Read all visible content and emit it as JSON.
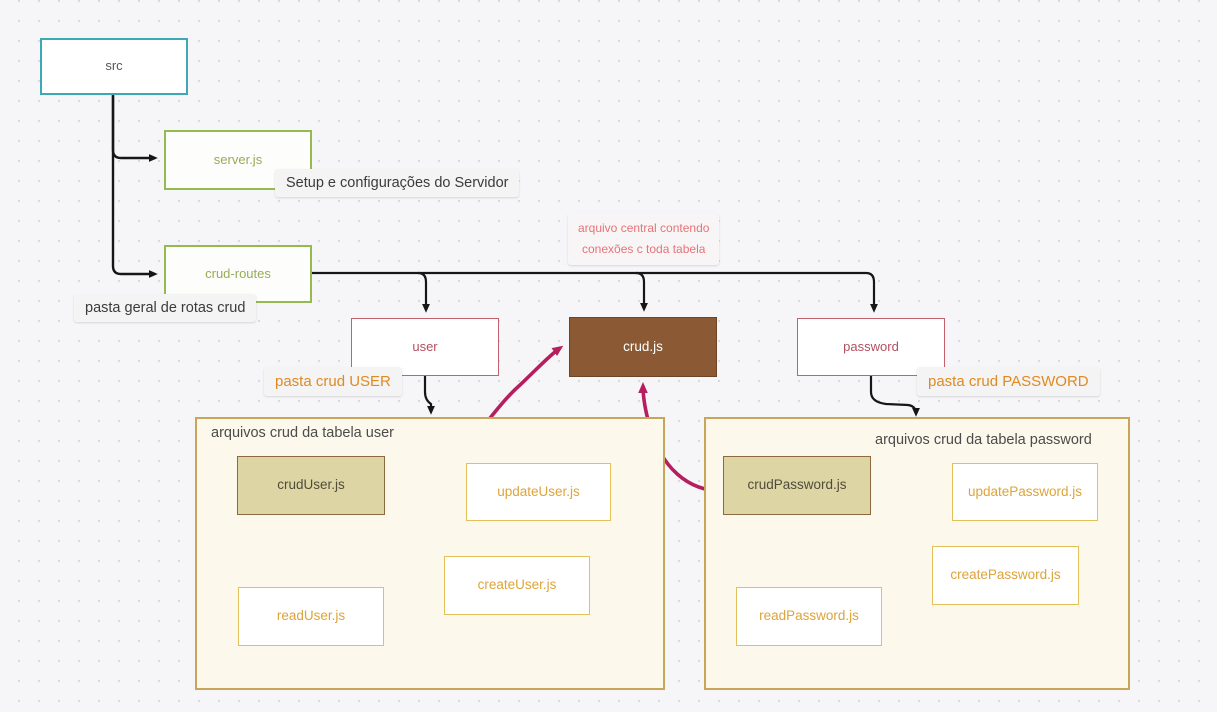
{
  "diagram": {
    "title": "Estrutura de pastas src / crud",
    "background": "#f6f6f8",
    "colors": {
      "src_border": "#3ca9b4",
      "green_border": "#95ba4f",
      "red_border": "#c0636f",
      "brown_fill": "#8b5a35",
      "khaki_fill": "#ded5a4",
      "yellow_border": "#e2c05a",
      "group_border": "#c8a558",
      "group_fill": "#fdf8ec",
      "magenta_edge": "#b51f60",
      "black_edge": "#161616",
      "dashed_edge": "#e0b458",
      "orange_text": "#e08a23",
      "red_text": "#e8737a"
    }
  },
  "nodes": {
    "src": "src",
    "server": "server.js",
    "crud_routes": "crud-routes",
    "user": "user",
    "crud_js": "crud.js",
    "password": "password",
    "crud_user": "crudUser.js",
    "update_user": "updateUser.js",
    "create_user": "createUser.js",
    "read_user": "readUser.js",
    "crud_password": "crudPassword.js",
    "update_password": "updatePassword.js",
    "create_password": "createPassword.js",
    "read_password": "readPassword.js"
  },
  "groups": {
    "user_group_title": "arquivos crud da tabela user",
    "password_group_title": "arquivos crud da tabela password"
  },
  "callouts": {
    "setup": "Setup e configurações do Servidor",
    "pasta_geral": "pasta geral de rotas crud",
    "pasta_crud_user": "pasta crud USER",
    "pasta_crud_password": "pasta crud PASSWORD",
    "arquivo_central_line1": "arquivo central contendo",
    "arquivo_central_line2": "conexões c toda tabela"
  }
}
